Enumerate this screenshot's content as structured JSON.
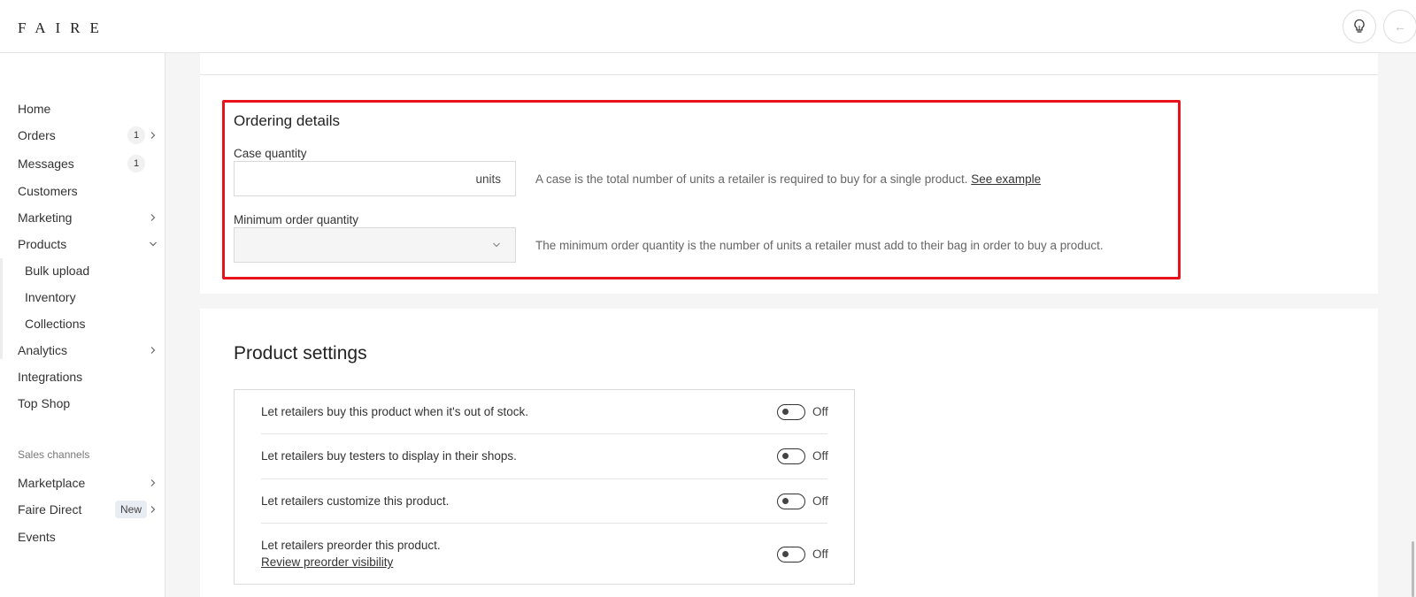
{
  "header": {
    "logo": "FAIRE",
    "icons": {
      "bulb": "lightbulb-icon",
      "back": "arrow-left-icon"
    }
  },
  "sidebar": {
    "items": [
      {
        "label": "Home"
      },
      {
        "label": "Orders",
        "badge": "1"
      },
      {
        "label": "Messages",
        "badge": "1"
      },
      {
        "label": "Customers"
      },
      {
        "label": "Marketing"
      },
      {
        "label": "Products"
      },
      {
        "label": "Bulk upload"
      },
      {
        "label": "Inventory"
      },
      {
        "label": "Collections"
      },
      {
        "label": "Analytics"
      },
      {
        "label": "Integrations"
      },
      {
        "label": "Top Shop"
      }
    ],
    "section_label": "Sales channels",
    "channels": [
      {
        "label": "Marketplace"
      },
      {
        "label": "Faire Direct",
        "pill": "New"
      },
      {
        "label": "Events"
      }
    ]
  },
  "ordering": {
    "title": "Ordering details",
    "case_quantity": {
      "label": "Case quantity",
      "value": "",
      "suffix": "units",
      "help": "A case is the total number of units a retailer is required to buy for a single product.",
      "help_link": "See example"
    },
    "minimum_order": {
      "label": "Minimum order quantity",
      "selected": "",
      "help": "The minimum order quantity is the number of units a retailer must add to their bag in order to buy a product."
    }
  },
  "product_settings": {
    "title": "Product settings",
    "rows": [
      {
        "label": "Let retailers buy this product when it's out of stock.",
        "state": "Off"
      },
      {
        "label": "Let retailers buy testers to display in their shops.",
        "state": "Off"
      },
      {
        "label": "Let retailers customize this product.",
        "state": "Off"
      },
      {
        "label": "Let retailers preorder this product.",
        "link": "Review preorder visibility",
        "state": "Off"
      }
    ]
  },
  "colors": {
    "highlight": "#e8121a",
    "text": "#333333",
    "muted": "#666666"
  }
}
